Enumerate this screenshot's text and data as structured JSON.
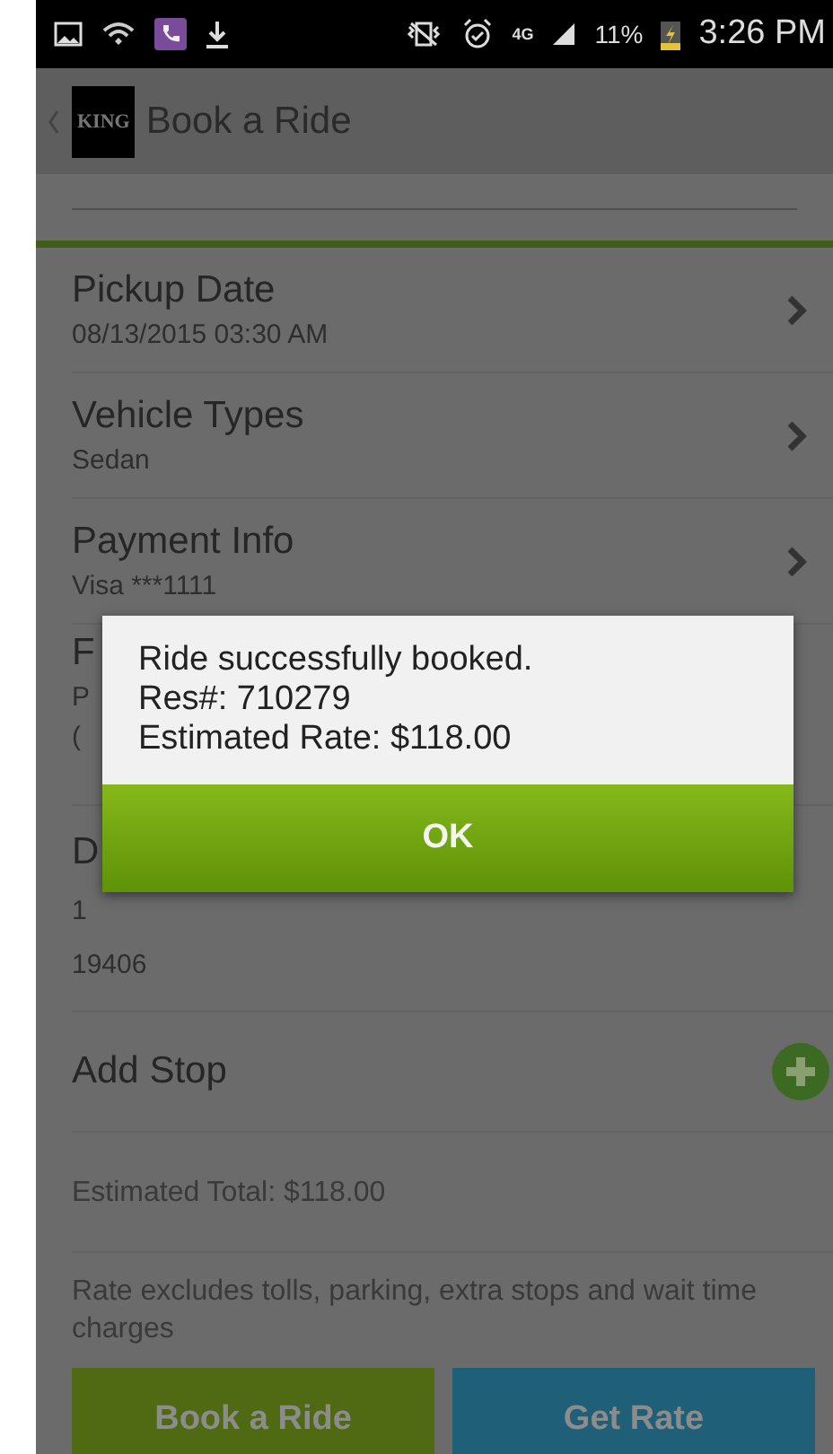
{
  "status_bar": {
    "network": "4G",
    "battery": "11%",
    "time": "3:26 PM"
  },
  "app_bar": {
    "logo": "KING",
    "title": "Book a Ride"
  },
  "rows": [
    {
      "kind": "nav",
      "label": "Pickup Date",
      "value": "08/13/2015 03:30 AM"
    },
    {
      "kind": "nav",
      "label": "Vehicle Types",
      "value": "Sedan"
    },
    {
      "kind": "nav",
      "label": "Payment Info",
      "value": "Visa ***1111"
    },
    {
      "kind": "covered",
      "label": "F",
      "lines": [
        "P",
        "("
      ]
    },
    {
      "kind": "covered",
      "label": "D",
      "lines": [
        "1",
        "19406"
      ]
    },
    {
      "kind": "add",
      "label": "Add Stop"
    },
    {
      "kind": "note",
      "label": "Estimated Total: $118.00"
    },
    {
      "kind": "note",
      "label": "Rate excludes tolls, parking, extra stops and wait time charges"
    }
  ],
  "buttons": [
    {
      "label": "Book a Ride",
      "color": "#4f6a12"
    },
    {
      "label": "Get Rate",
      "color": "#1f5f78"
    }
  ],
  "dialog": {
    "lines": [
      "Ride successfully booked.",
      "Res#: 710279",
      "Estimated Rate: $118.00"
    ],
    "button": "OK"
  }
}
